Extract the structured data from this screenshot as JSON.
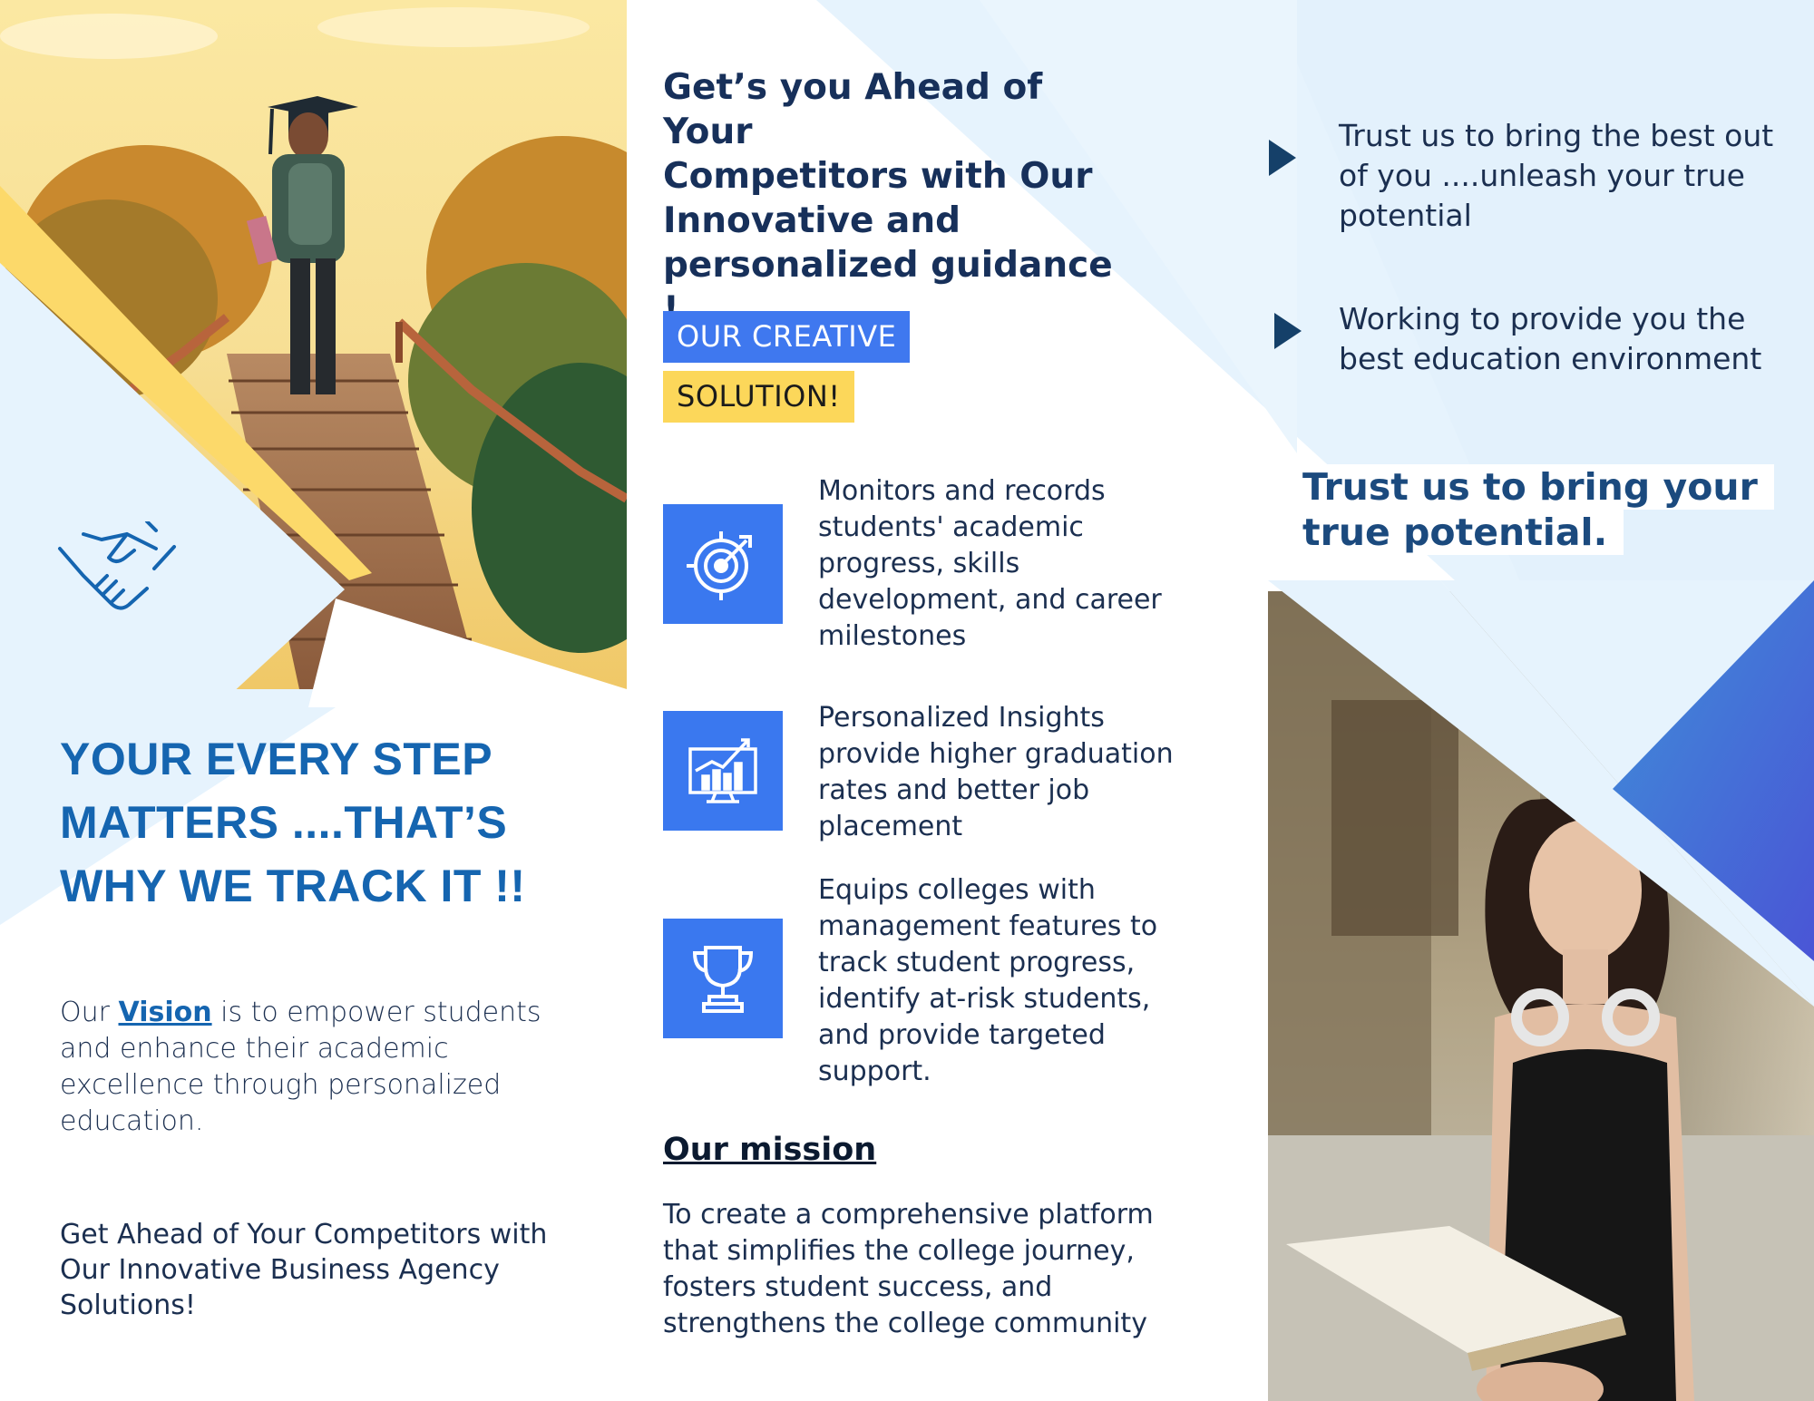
{
  "left": {
    "tagline_lines": [
      "YOUR EVERY STEP",
      "MATTERS ....THAT’S",
      "WHY WE TRACK IT  !!"
    ],
    "vision": {
      "prefix": "Our ",
      "keyword": "Vision",
      "suffix": " is to empower students and enhance their academic excellence through personalized education."
    },
    "get_ahead": "Get Ahead of Your Competitors with Our Innovative Business Agency Solutions!"
  },
  "middle": {
    "heading_lines": [
      "Get’s you Ahead of Your",
      "Competitors with Our",
      "Innovative and",
      "personalized guidance !"
    ],
    "pill_blue": "OUR CREATIVE",
    "pill_yellow": "SOLUTION!",
    "features": [
      {
        "icon": "target-icon",
        "text": "Monitors and records students' academic progress, skills development, and career milestones"
      },
      {
        "icon": "growth-chart-icon",
        "text": "Personalized Insights provide higher graduation rates and better job placement"
      },
      {
        "icon": "trophy-icon",
        "text": "Equips colleges with management features to track student progress, identify at-risk students, and provide targeted support."
      }
    ],
    "mission_title": "Our mission",
    "mission_text": "To create a comprehensive platform that simplifies the college journey, fosters student success, and strengthens the college community"
  },
  "right": {
    "bullets": [
      "Trust us to bring the best out of you ....unleash your true potential",
      "Working to provide you the best education environment"
    ],
    "trust_lines": [
      "Trust us to bring your",
      "true potential."
    ]
  },
  "colors": {
    "accent_blue": "#3a78ef",
    "accent_yellow": "#fcd75a",
    "navy": "#17305a",
    "light_blue_bg": "#e6f3fd",
    "tagline_blue": "#1565b0"
  }
}
